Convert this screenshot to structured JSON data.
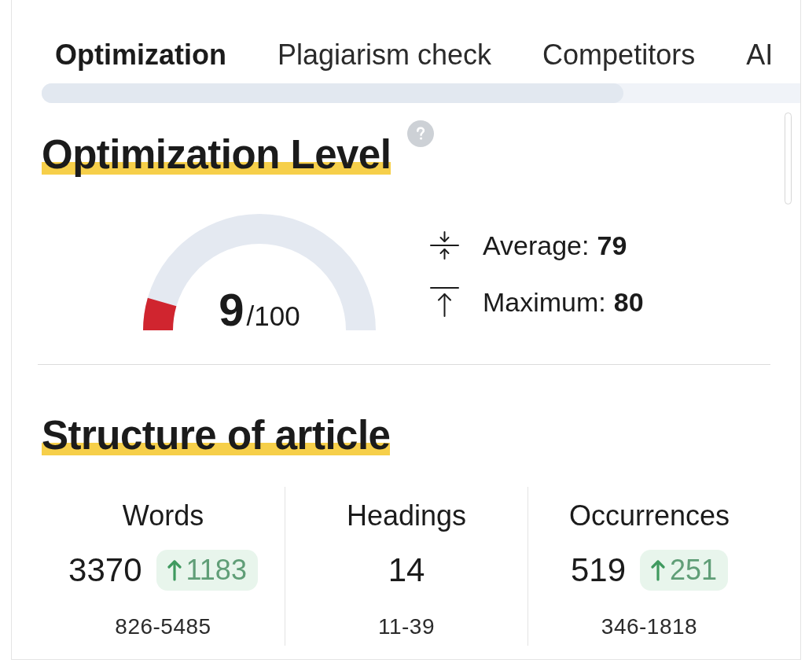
{
  "tabs": [
    {
      "label": "Optimization",
      "selected": true
    },
    {
      "label": "Plagiarism check",
      "selected": false
    },
    {
      "label": "Competitors",
      "selected": false
    },
    {
      "label": "AI",
      "selected": false
    }
  ],
  "optimization_level": {
    "title": "Optimization Level",
    "gauge": {
      "score": "9",
      "max": "/100",
      "level": 0.09
    },
    "stats": [
      {
        "kind": "average",
        "label": "Average:",
        "value": "79"
      },
      {
        "kind": "maximum",
        "label": "Maximum:",
        "value": "80"
      }
    ]
  },
  "structure": {
    "title": "Structure of article",
    "metrics": [
      {
        "label": "Words",
        "value": "3370",
        "change": "1183",
        "range": "826-5485"
      },
      {
        "label": "Headings",
        "value": "14",
        "range": "11-39"
      },
      {
        "label": "Occurrences",
        "value": "519",
        "change": "251",
        "range": "346-1818"
      }
    ]
  }
}
